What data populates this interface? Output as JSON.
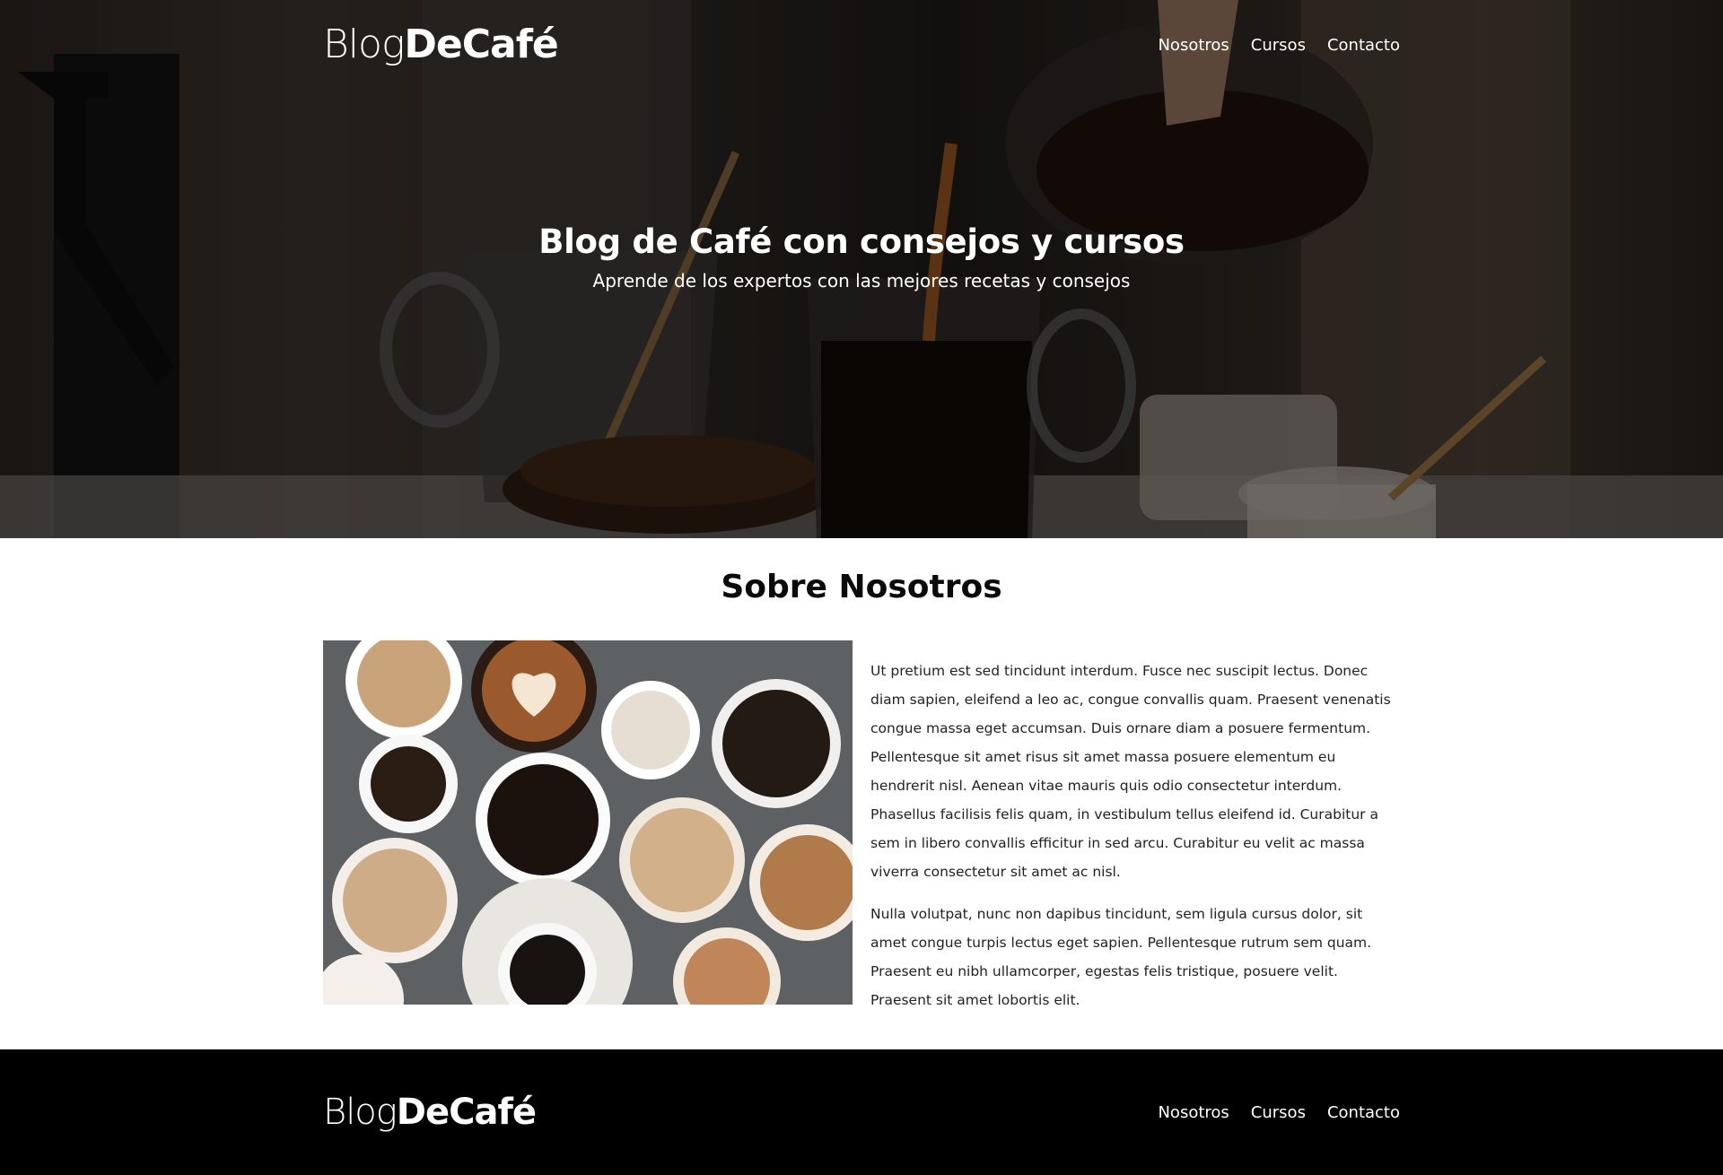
{
  "brand": {
    "light": "Blog",
    "bold": "DeCafé"
  },
  "nav": [
    {
      "label": "Nosotros"
    },
    {
      "label": "Cursos"
    },
    {
      "label": "Contacto"
    }
  ],
  "hero": {
    "title": "Blog de Café con consejos y cursos",
    "subtitle": "Aprende de los expertos con las mejores recetas y consejos"
  },
  "about": {
    "title": "Sobre Nosotros",
    "paragraphs": [
      "Ut pretium est sed tincidunt interdum. Fusce nec suscipit lectus. Donec diam sapien, eleifend a leo ac, congue convallis quam. Praesent venenatis congue massa eget accumsan. Duis ornare diam a posuere fermentum. Pellentesque sit amet risus sit amet massa posuere elementum eu hendrerit nisl. Aenean vitae mauris quis odio consectetur interdum. Phasellus facilisis felis quam, in vestibulum tellus eleifend id. Curabitur a sem in libero convallis efficitur in sed arcu. Curabitur eu velit ac massa viverra consectetur sit amet ac nisl.",
      "Nulla volutpat, nunc non dapibus tincidunt, sem ligula cursus dolor, sit amet congue turpis lectus eget sapien. Pellentesque rutrum sem quam. Praesent eu nibh ullamcorper, egestas felis tristique, posuere velit. Praesent sit amet lobortis elit."
    ]
  },
  "footer": {
    "brand": {
      "light": "Blog",
      "bold": "DeCafé"
    },
    "nav": [
      {
        "label": "Nosotros"
      },
      {
        "label": "Cursos"
      },
      {
        "label": "Contacto"
      }
    ]
  },
  "colors": {
    "footer_bg": "#000000",
    "text": "#222222",
    "hero_text": "#ffffff"
  }
}
